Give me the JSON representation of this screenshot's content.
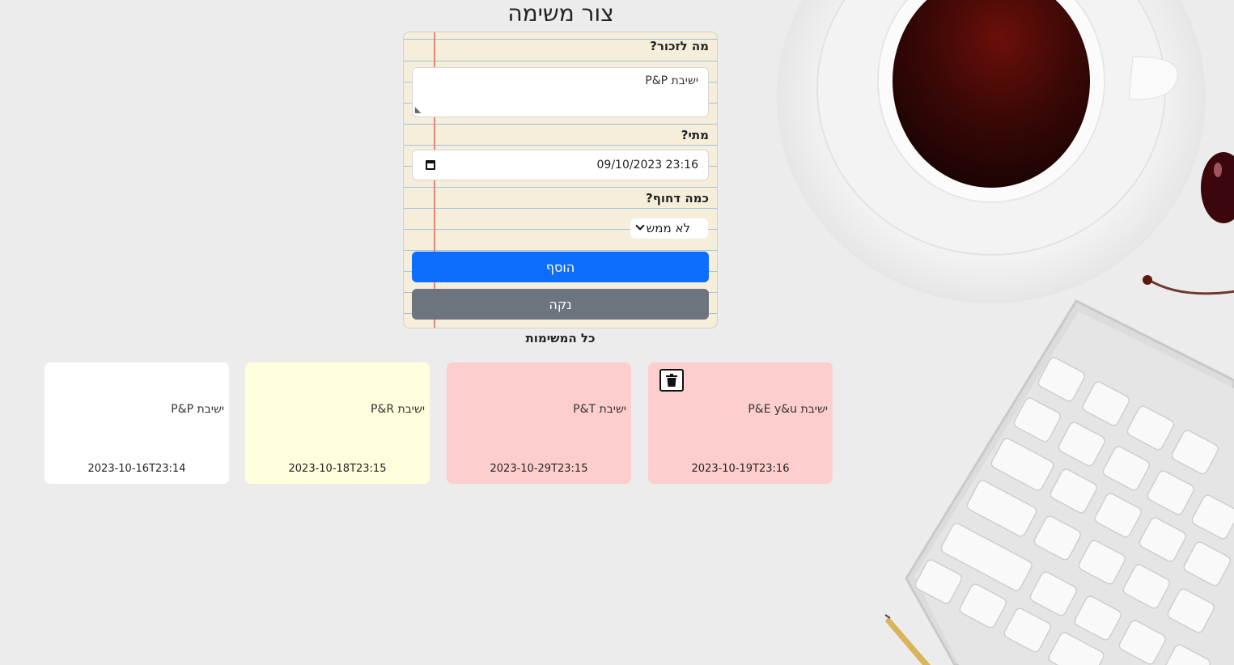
{
  "page": {
    "title": "צור משימה"
  },
  "form": {
    "what_label": "מה לזכור?",
    "what_value": "ישיבת P&P",
    "when_label": "מתי?",
    "when_value": "09/10/2023 23:16",
    "urgency_label": "כמה דחוף?",
    "urgency_selected": "לא ממש",
    "add_button": "הוסף",
    "clear_button": "נקה"
  },
  "notes_section": {
    "title": "כל המשימות"
  },
  "notes": [
    {
      "text": "ישיבת P&P",
      "date": "2023-10-16T23:14",
      "color": "#ffffff",
      "urgency": "low"
    },
    {
      "text": "ישיבת P&R",
      "date": "2023-10-18T23:15",
      "color": "#ffffdd",
      "urgency": "medium"
    },
    {
      "text": "ישיבת P&T",
      "date": "2023-10-29T23:15",
      "color": "#fecece",
      "urgency": "high"
    },
    {
      "text": "ישיבת P&E y&u",
      "date": "2023-10-19T23:16",
      "color": "#fecece",
      "urgency": "high",
      "hovered": true,
      "delete_icon": "trash-icon"
    }
  ],
  "colors": {
    "primary": "#0d6efd",
    "secondary": "#6c757d",
    "note_white": "#ffffff",
    "note_yellow": "#ffffdd",
    "note_pink": "#fecece",
    "paper": "#f4eedb"
  }
}
